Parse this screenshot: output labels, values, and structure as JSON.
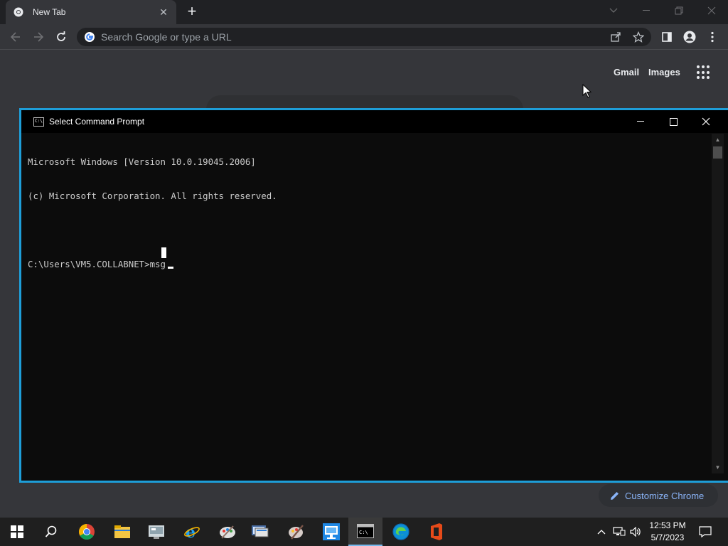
{
  "browser": {
    "tab": {
      "title": "New Tab"
    },
    "omnibox": {
      "placeholder": "Search Google or type a URL"
    },
    "ntp": {
      "gmail": "Gmail",
      "images": "Images",
      "customize_label": "Customize Chrome"
    }
  },
  "cmd": {
    "title": "Select Command Prompt",
    "lines": [
      "Microsoft Windows [Version 10.0.19045.2006]",
      "(c) Microsoft Corporation. All rights reserved.",
      "",
      "C:\\Users\\VM5.COLLABNET>msg"
    ]
  },
  "taskbar": {
    "apps": [
      "start-icon",
      "search-icon",
      "chrome-icon",
      "file-explorer-icon",
      "control-panel-icon",
      "internet-explorer-icon",
      "paint-icon",
      "remote-desktop-icon",
      "paint-brush-icon",
      "network-icon",
      "command-prompt-icon",
      "edge-icon",
      "office-icon"
    ],
    "clock": {
      "time": "12:53 PM",
      "date": "5/7/2023"
    }
  },
  "colors": {
    "cmd_border": "#1e9ed8",
    "link_blue": "#8ab4f8",
    "chrome_bg": "#35363a"
  }
}
